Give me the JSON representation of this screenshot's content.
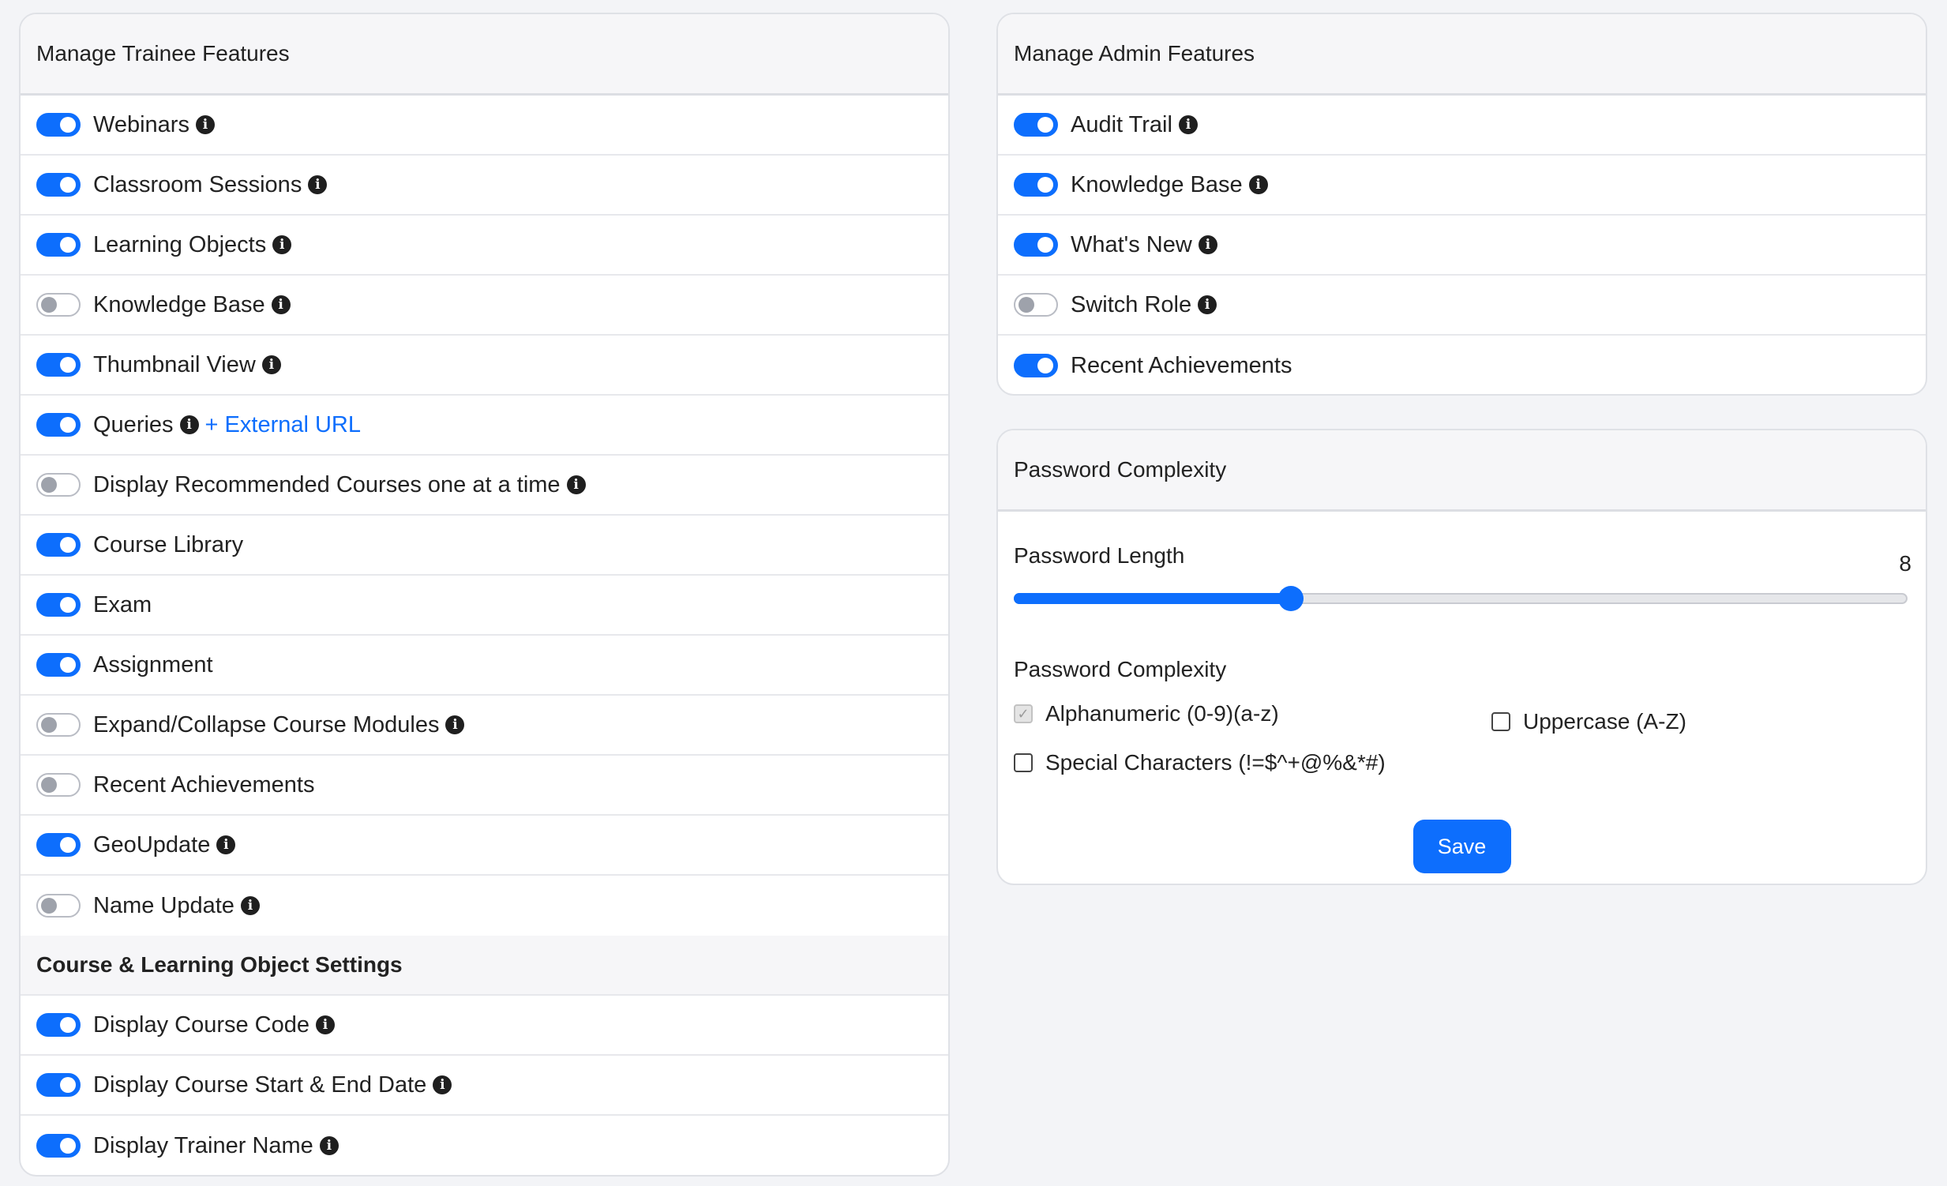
{
  "colors": {
    "accent": "#0d6efd",
    "toggle_off": "#9ea2ab",
    "header_bg": "#f6f6f8"
  },
  "trainee": {
    "title": "Manage Trainee Features",
    "items": [
      {
        "label": "Webinars",
        "on": true,
        "info": true
      },
      {
        "label": "Classroom Sessions",
        "on": true,
        "info": true
      },
      {
        "label": "Learning Objects",
        "on": true,
        "info": true
      },
      {
        "label": "Knowledge Base",
        "on": false,
        "info": true
      },
      {
        "label": "Thumbnail View",
        "on": true,
        "info": true
      },
      {
        "label": "Queries",
        "on": true,
        "info": true,
        "link": "+ External URL"
      },
      {
        "label": "Display Recommended Courses one at a time",
        "on": false,
        "info": true
      },
      {
        "label": "Course Library",
        "on": true,
        "info": false
      },
      {
        "label": "Exam",
        "on": true,
        "info": false
      },
      {
        "label": "Assignment",
        "on": true,
        "info": false
      },
      {
        "label": "Expand/Collapse Course Modules",
        "on": false,
        "info": true
      },
      {
        "label": "Recent Achievements",
        "on": false,
        "info": false
      },
      {
        "label": "GeoUpdate",
        "on": true,
        "info": true
      },
      {
        "label": "Name Update",
        "on": false,
        "info": true
      }
    ],
    "section_title": "Course & Learning Object Settings",
    "section_items": [
      {
        "label": "Display Course Code",
        "on": true,
        "info": true
      },
      {
        "label": "Display Course Start & End Date",
        "on": true,
        "info": true
      },
      {
        "label": "Display Trainer Name",
        "on": true,
        "info": true
      }
    ]
  },
  "admin": {
    "title": "Manage Admin Features",
    "items": [
      {
        "label": "Audit Trail",
        "on": true,
        "info": true
      },
      {
        "label": "Knowledge Base",
        "on": true,
        "info": true
      },
      {
        "label": "What's New",
        "on": true,
        "info": true
      },
      {
        "label": "Switch Role",
        "on": false,
        "info": true
      },
      {
        "label": "Recent Achievements",
        "on": true,
        "info": false
      }
    ]
  },
  "password": {
    "title": "Password Complexity",
    "length_label": "Password Length",
    "length_value": "8",
    "length_fraction": 0.31,
    "complexity_label": "Password Complexity",
    "options": [
      {
        "label": "Alphanumeric (0-9)(a-z)",
        "checked": true,
        "disabled": true
      },
      {
        "label": "Uppercase (A-Z)",
        "checked": false,
        "disabled": false
      },
      {
        "label": "Special Characters (!=$^+@%&*#)",
        "checked": false,
        "disabled": false
      }
    ],
    "save_label": "Save"
  },
  "info_glyph": "i"
}
